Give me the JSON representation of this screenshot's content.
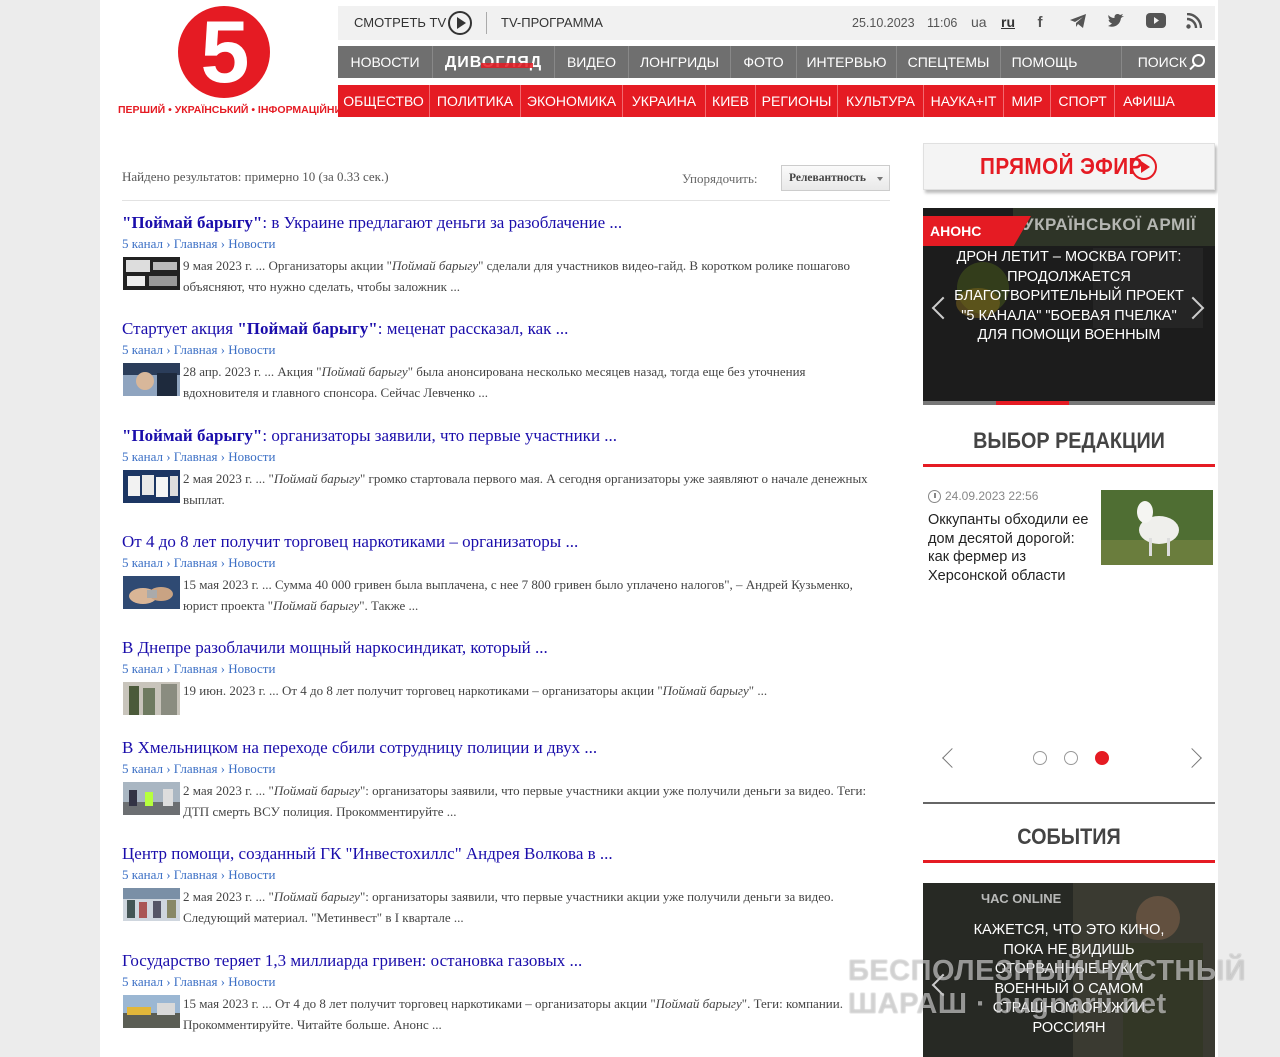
{
  "header": {
    "logo_digit": "5",
    "logo_tagline": "ПЕРШИЙ • УКРАЇНСЬКИЙ • ІНФОРМАЦІЙНИЙ",
    "watch_tv": "СМОТРЕТЬ TV",
    "tv_program": "TV-ПРОГРАММА",
    "date": "25.10.2023",
    "time": "11:06",
    "lang_ua": "ua",
    "lang_ru": "ru",
    "social_icons": [
      "facebook-icon",
      "telegram-icon",
      "twitter-icon",
      "youtube-icon",
      "rss-icon"
    ]
  },
  "main_nav": {
    "items": [
      "НОВОСТИ",
      "ДИВОГЛЯД",
      "ВИДЕО",
      "ЛОНГРИДЫ",
      "ФОТО",
      "ИНТЕРВЬЮ",
      "СПЕЦТЕМЫ",
      "ПОМОЩЬ"
    ],
    "search": "ПОИСК"
  },
  "category_nav": {
    "items": [
      "ОБЩЕСТВО",
      "ПОЛИТИКА",
      "ЭКОНОМИКА",
      "УКРАИНА",
      "КИЕВ",
      "РЕГИОНЫ",
      "КУЛЬТУРА",
      "НАУКА+IT",
      "МИР",
      "СПОРТ",
      "АФИША"
    ]
  },
  "search": {
    "results_info": "Найдено результатов: примерно 10 (за 0.33 сек.)",
    "sort_label": "Упорядочить:",
    "sort_value": "Релевантность"
  },
  "results": [
    {
      "title_bold": "\"Поймай барыгу\"",
      "title_rest": ": в Украине предлагают деньги за разоблачение ...",
      "crumb": "5 канал › Главная › Новости",
      "snippet_pre": "9 мая 2023 г. ... Организаторы акции \"",
      "snippet_em": "Поймай барыгу",
      "snippet_post": "\" сделали для участников видео-гайд. В коротком ролике пошагово объясняют, что нужно сделать, чтобы заложник ..."
    },
    {
      "title_pre": "Стартует акция ",
      "title_bold": "\"Поймай барыгу\"",
      "title_rest": ": меценат рассказал, как ...",
      "crumb": "5 канал › Главная › Новости",
      "snippet_pre": "28 апр. 2023 г. ... Акция \"",
      "snippet_em": "Поймай барыгу",
      "snippet_post": "\" была анонсирована несколько месяцев назад, тогда еще без уточнения вдохновителя и главного спонсора. Сейчас Левченко ..."
    },
    {
      "title_bold": "\"Поймай барыгу\"",
      "title_rest": ": организаторы заявили, что первые участники ...",
      "crumb": "5 канал › Главная › Новости",
      "snippet_pre": "2 мая 2023 г. ... \"",
      "snippet_em": "Поймай барыгу",
      "snippet_post": "\" громко стартовала первого мая. А сегодня организаторы уже заявляют о начале денежных выплат."
    },
    {
      "title_rest": "От 4 до 8 лет получит торговец наркотиками – организаторы ...",
      "crumb": "5 канал › Главная › Новости",
      "snippet_pre": "15 мая 2023 г. ... Сумма 40 000 гривен была выплачена, с нее 7 800 гривен было уплачено налогов\", – Андрей Кузьменко, юрист проекта \"",
      "snippet_em": "Поймай барыгу",
      "snippet_post": "\". Также ..."
    },
    {
      "title_rest": "В Днепре разоблачили мощный наркосиндикат, который ...",
      "crumb": "5 канал › Главная › Новости",
      "snippet_pre": "19 июн. 2023 г. ... От 4 до 8 лет получит торговец наркотиками – организаторы акции \"",
      "snippet_em": "Поймай барыгу",
      "snippet_post": "\" ..."
    },
    {
      "title_rest": "В Хмельницком на переходе сбили сотрудницу полиции и двух ...",
      "crumb": "5 канал › Главная › Новости",
      "snippet_pre": "2 мая 2023 г. ... \"",
      "snippet_em": "Поймай барыгу",
      "snippet_post": "\": организаторы заявили, что первые участники акции уже получили деньги за видео. Теги: ДТП смерть ВСУ полиция. Прокомментируйте ..."
    },
    {
      "title_rest": "Центр помощи, созданный ГК \"Инвестохиллс\" Андрея Волкова в ...",
      "crumb": "5 канал › Главная › Новости",
      "snippet_pre": "2 мая 2023 г. ... \"",
      "snippet_em": "Поймай барыгу",
      "snippet_post": "\": организаторы заявили, что первые участники акции уже получили деньги за видео. Следующий материал. \"Метинвест\" в I квартале ..."
    },
    {
      "title_rest": "Государство теряет 1,3 миллиарда гривен: остановка газовых ...",
      "crumb": "5 канал › Главная › Новости",
      "snippet_pre": "15 мая 2023 г. ... От 4 до 8 лет получит торговец наркотиками – организаторы акции \"",
      "snippet_em": "Поймай барыгу",
      "snippet_post": "\". Теги: компании. Прокомментируйте. Читайте больше. Анонс ..."
    }
  ],
  "sidebar": {
    "live": "ПРЯМОЙ ЭФИР",
    "announce_badge": "АНОНС",
    "announce_top": "УКРАЇНСЬКОЇ АРМІЇ",
    "announce_text": "Дрон летит – Москва горит: продолжается благотворительный проект \"5 канала\" \"Боевая пчелка\" для помощи военным",
    "editors_heading": "ВЫБОР РЕДАКЦИИ",
    "editors_date": "24.09.2023 22:56",
    "editors_title": "Оккупанты обходили ее дом десятой дорогой: как фермер из Херсонской области",
    "events_heading": "СОБЫТИЯ",
    "events_label": "ЧАС ONLINE",
    "events_text": "Кажется, что это кино, пока не видишь оторванные руки: военный о самом страшном оружии россиян"
  },
  "watermark": {
    "line1": "БЕСПОЛЕЗНЫЙ ЧАСТНЫЙ",
    "line2": "ШАРАШ · bugnarii.net"
  }
}
